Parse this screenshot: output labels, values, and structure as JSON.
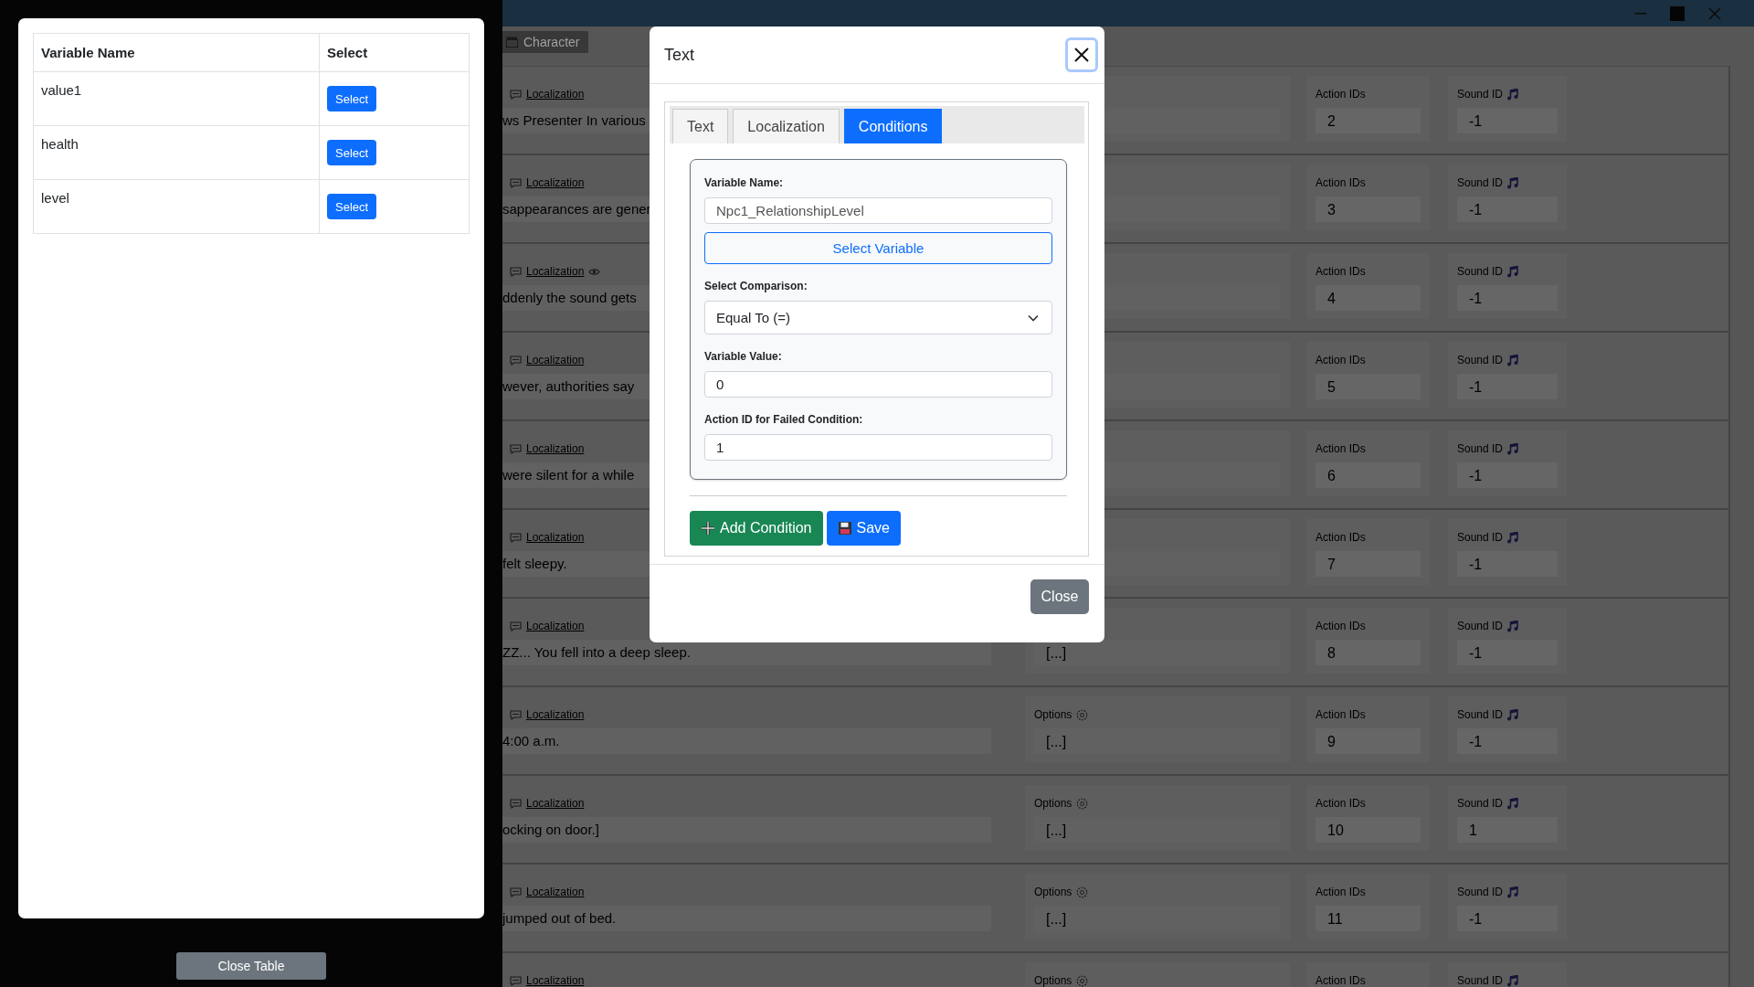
{
  "background": {
    "tab": "Character",
    "rows": [
      {
        "link": "Localization",
        "text": "ws Presenter In various",
        "action_label": "Action IDs",
        "action_value": "2",
        "sound_label": "Sound ID",
        "sound_value": "-1"
      },
      {
        "link": "Localization",
        "text": "sappearances are gener",
        "action_label": "Action IDs",
        "action_value": "3",
        "sound_label": "Sound ID",
        "sound_value": "-1"
      },
      {
        "link": "Localization",
        "watch_icon": true,
        "text": "ddenly the sound gets",
        "action_label": "Action IDs",
        "action_value": "4",
        "sound_label": "Sound ID",
        "sound_value": "-1"
      },
      {
        "link": "Localization",
        "text": "wever, authorities say",
        "action_label": "Action IDs",
        "action_value": "5",
        "sound_label": "Sound ID",
        "sound_value": "-1"
      },
      {
        "link": "Localization",
        "text": "were silent for a while",
        "action_label": "Action IDs",
        "action_value": "6",
        "sound_label": "Sound ID",
        "sound_value": "-1"
      },
      {
        "link": "Localization",
        "text": "felt sleepy.",
        "action_label": "Action IDs",
        "action_value": "7",
        "sound_label": "Sound ID",
        "sound_value": "-1"
      },
      {
        "link": "Localization",
        "text": "ZZ... You fell into a deep sleep.",
        "options_value": "[...]",
        "action_label": "Action IDs",
        "action_value": "8",
        "sound_label": "Sound ID",
        "sound_value": "-1"
      },
      {
        "link": "Localization",
        "text": "4:00 a.m.",
        "options_label": "Options",
        "options_value": "[...]",
        "action_label": "Action IDs",
        "action_value": "9",
        "sound_label": "Sound ID",
        "sound_value": "-1"
      },
      {
        "link": "Localization",
        "text": "ocking on door.]",
        "options_label": "Options",
        "options_value": "[...]",
        "action_label": "Action IDs",
        "action_value": "10",
        "sound_label": "Sound ID",
        "sound_value": "1"
      },
      {
        "link": "Localization",
        "text": "jumped out of bed.",
        "options_label": "Options",
        "options_value": "[...]",
        "action_label": "Action IDs",
        "action_value": "11",
        "sound_label": "Sound ID",
        "sound_value": "-1"
      },
      {
        "link": "Localization",
        "options_label": "Options",
        "action_label": "Action IDs",
        "sound_label": "Sound ID"
      }
    ]
  },
  "variable_table": {
    "columns": [
      "Variable Name",
      "Select"
    ],
    "rows": [
      {
        "name": "value1",
        "button": "Select"
      },
      {
        "name": "health",
        "button": "Select"
      },
      {
        "name": "level",
        "button": "Select"
      }
    ],
    "close_button": "Close Table"
  },
  "modal": {
    "title": "Text",
    "tabs": [
      {
        "label": "Text",
        "selected": false
      },
      {
        "label": "Localization",
        "selected": false
      },
      {
        "label": "Conditions",
        "selected": true
      }
    ],
    "fields": [
      {
        "kind": "input",
        "label": "Variable Name:",
        "value": "Npc1_RelationshipLevel"
      },
      {
        "kind": "button",
        "label": "Select Variable"
      },
      {
        "kind": "select",
        "label": "Select Comparison:",
        "value": "Equal To (=)"
      },
      {
        "kind": "input",
        "label": "Variable Value:",
        "value": "0"
      },
      {
        "kind": "input",
        "label": "Action ID for Failed Condition:",
        "value": "1"
      }
    ],
    "actions": [
      {
        "kind": "add",
        "label": "Add Condition"
      },
      {
        "kind": "save",
        "label": "Save"
      }
    ],
    "footer_button": "Close"
  }
}
